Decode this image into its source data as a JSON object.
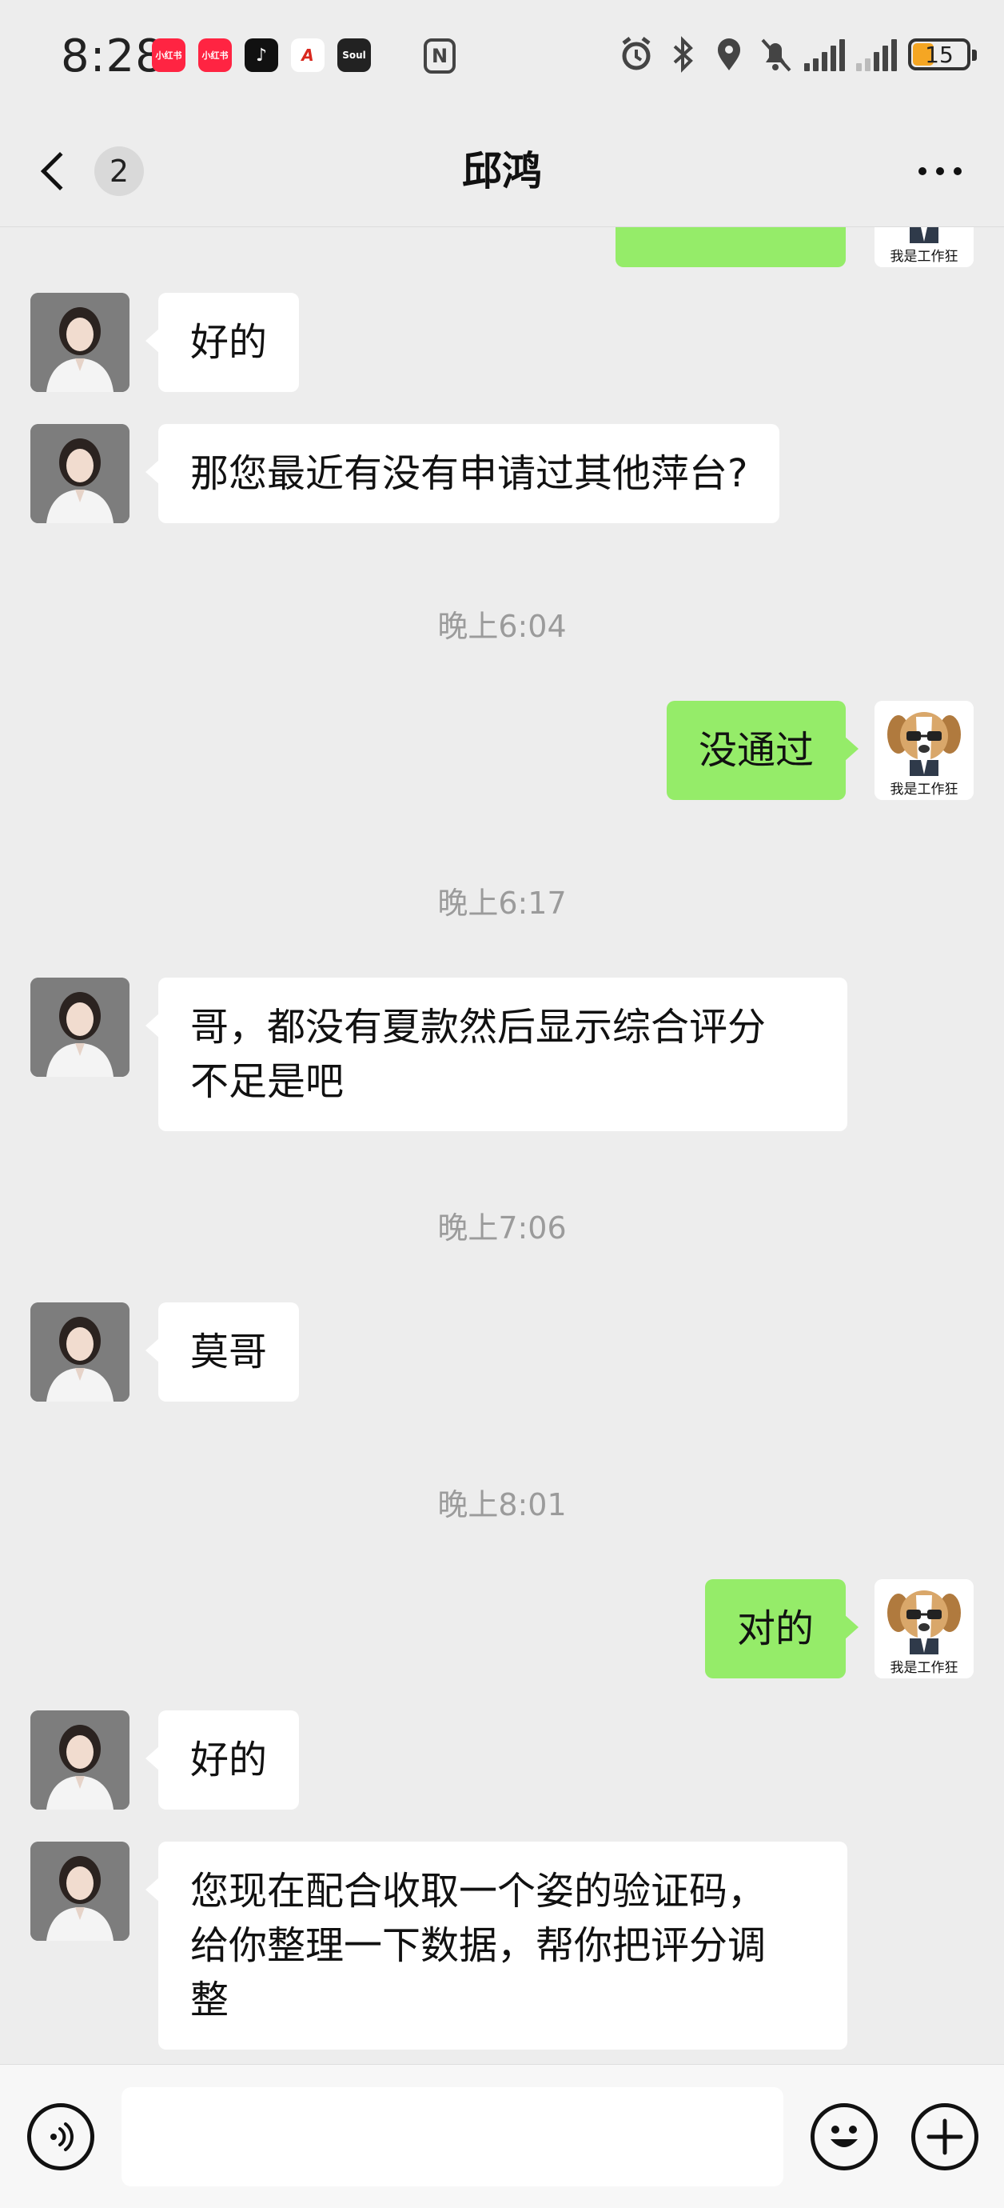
{
  "status_bar": {
    "time": "8:28",
    "apps": [
      "小红书",
      "小红书",
      "TikTok",
      "A",
      "Soul"
    ],
    "battery": "15"
  },
  "nav": {
    "unread_count": "2",
    "title": "邱鸿"
  },
  "messages": [
    {
      "side": "right",
      "type": "bubble_clipped",
      "text": ""
    },
    {
      "side": "left",
      "type": "bubble",
      "text": "好的"
    },
    {
      "side": "left",
      "type": "bubble",
      "text": "那您最近有没有申请过其他萍台?"
    },
    {
      "type": "time",
      "text": "晚上6:04"
    },
    {
      "side": "right",
      "type": "bubble",
      "text": "没通过"
    },
    {
      "type": "time",
      "text": "晚上6:17"
    },
    {
      "side": "left",
      "type": "bubble",
      "text_lines": [
        "哥，都没有夏款然后显示综合评分",
        "不足是吧"
      ]
    },
    {
      "type": "time",
      "text": "晚上7:06"
    },
    {
      "side": "left",
      "type": "bubble",
      "text": "莫哥"
    },
    {
      "type": "time",
      "text": "晚上8:01"
    },
    {
      "side": "right",
      "type": "bubble",
      "text": "对的"
    },
    {
      "side": "left",
      "type": "bubble",
      "text": "好的"
    },
    {
      "side": "left",
      "type": "bubble",
      "text_lines": [
        "您现在配合收取一个姿的验证码，",
        "给你整理一下数据，帮你把评分调",
        "整"
      ]
    }
  ],
  "self_avatar_caption": "我是工作狂",
  "input": {
    "value": ""
  },
  "colors": {
    "background": "#ededed",
    "self_bubble": "#95ec69",
    "other_bubble": "#ffffff",
    "timestamp": "#9b9b9b"
  },
  "icons": {
    "back": "chevron-left-icon",
    "more": "more-dots-icon",
    "voice": "voice-icon",
    "emoji": "emoji-icon",
    "plus": "plus-icon"
  }
}
